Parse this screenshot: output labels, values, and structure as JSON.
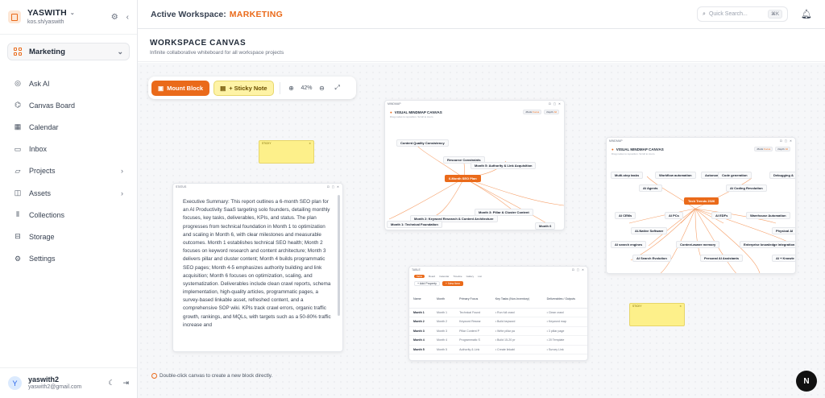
{
  "brand": {
    "name": "YASWITH",
    "sub": "kos.sh/yaswith"
  },
  "workspace_select": {
    "value": "Marketing"
  },
  "nav": [
    {
      "label": "Ask AI",
      "icon": "ai-icon"
    },
    {
      "label": "Canvas Board",
      "icon": "canvas-icon"
    },
    {
      "label": "Calendar",
      "icon": "calendar-icon"
    },
    {
      "label": "Inbox",
      "icon": "inbox-icon"
    },
    {
      "label": "Projects",
      "icon": "folder-icon",
      "arrow": "›"
    },
    {
      "label": "Assets",
      "icon": "book-icon",
      "arrow": "›"
    },
    {
      "label": "Collections",
      "icon": "library-icon"
    },
    {
      "label": "Storage",
      "icon": "storage-icon"
    },
    {
      "label": "Settings",
      "icon": "gear-icon"
    }
  ],
  "user": {
    "name": "yaswith2",
    "email": "yaswith2@gmail.com",
    "initial": "Y"
  },
  "topbar": {
    "prefix": "Active Workspace:",
    "workspace": "MARKETING",
    "search_placeholder": "Quick Search...",
    "shortcut": "⌘K"
  },
  "header": {
    "title": "WORKSPACE CANVAS",
    "subtitle": "Infinite collaborative whiteboard for all workspace projects"
  },
  "toolbar": {
    "mount_label": "Mount Block",
    "sticky_label": "+ Sticky Note",
    "zoom": "42%"
  },
  "doc_block": {
    "label": "STATUS",
    "text": "Executive Summary: This report outlines a 6-month SEO plan for an AI Productivity SaaS targeting solo founders, detailing monthly focuses, key tasks, deliverables, KPIs, and status. The plan progresses from technical foundation in Month 1 to optimization and scaling in Month 6, with clear milestones and measurable outcomes. Month 1 establishes technical SEO health; Month 2 focuses on keyword research and content architecture; Month 3 delivers pillar and cluster content; Month 4 builds programmatic SEO pages; Month 4-5 emphasizes authority building and link acquisition; Month 6 focuses on optimization, scaling, and systematization. Deliverables include clean crawl reports, schema implementation, high-quality articles, programmatic pages, a survey-based linkable asset, refreshed content, and a comprehensive SOP wiki. KPIs track crawl errors, organic traffic growth, rankings, and MQLs, with targets such as a 50-80% traffic increase and"
  },
  "sticky_notes": [
    {
      "label": "STICKY"
    },
    {
      "label": "STICKY"
    }
  ],
  "mindmap_1": {
    "label": "MINDMAP",
    "title": "VISUAL MINDMAP CANVAS",
    "subtitle": "Drag nodes to reposition. Scroll to zoom.",
    "filter_a": "Mode",
    "filter_a_val": "Focus",
    "filter_b": "Depth",
    "filter_b_val": "All",
    "nodes": [
      "Content Quality Consistency",
      "Resource Constraints",
      "Month 5: Authority & Link Acquisition",
      "6-Month SEO Plan",
      "Month 3: Pillar & Cluster Content",
      "Month 2: Keyword Research & Content Architecture",
      "Month 1: Technical Foundation",
      "Month 6"
    ]
  },
  "mindmap_2": {
    "label": "MINDMAP",
    "title": "VISUAL MINDMAP CANVAS",
    "subtitle": "Drag nodes to reposition. Scroll to zoom.",
    "filter_a": "Mode",
    "filter_a_val": "Focus",
    "filter_b": "Depth",
    "filter_b_val": "All",
    "nodes": [
      "Multi-step tasks",
      "Workflow automation",
      "Autonomous",
      "Code generation",
      "Debugging &",
      "AI Agents",
      "AI Coding Revolution",
      "Tech Trends 2026",
      "AI CEMs",
      "AI PCs",
      "AI EDFs",
      "Warehouse Automation",
      "AI-Native Software",
      "Physical AI",
      "AI search engines",
      "Context-aware memory",
      "Enterprise knowledge integration",
      "AI Search Evolution",
      "Personal AI Assistants",
      "AI + Knowle"
    ]
  },
  "table_block": {
    "label": "TABLE",
    "tabs": [
      "Table",
      "Board",
      "Calendar",
      "Timeline",
      "Gallery",
      "List"
    ],
    "actions": [
      "+ Add Property",
      "+ New Item"
    ],
    "headers": [
      "Name",
      "Month",
      "Primary Focus",
      "Key Tasks (Non-Inventory)",
      "Deliverables / Outputs"
    ],
    "rows": [
      [
        "Month 1",
        "Month 1",
        "Technical Found",
        "• Run full crawl",
        "• Clean crawl"
      ],
      [
        "Month 2",
        "Month 2",
        "Keyword Resear",
        "• Build keyword",
        "• Keyword map"
      ],
      [
        "Month 3",
        "Month 3",
        "Pillar Content P",
        "• Write pillar pa",
        "• 3 pillar page"
      ],
      [
        "Month 4",
        "Month 4",
        "Programmatic S",
        "• Build 15-20 pr",
        "• 20 Template"
      ],
      [
        "Month 5",
        "Month 5",
        "Authority & Link",
        "• Create linkabl",
        "• Survey Link"
      ]
    ]
  },
  "hint": "Double-click canvas to create a new block directly.",
  "fab": "N",
  "colors": {
    "accent": "#ea6a1a",
    "sticky": "#fdf08a"
  }
}
